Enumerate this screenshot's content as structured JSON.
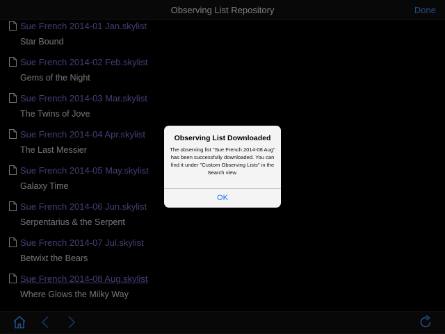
{
  "navbar": {
    "title": "Observing List Repository",
    "done_label": "Done"
  },
  "list": {
    "items": [
      {
        "file": "Sue French 2014-01 Jan.skylist",
        "title": "Star Bound",
        "icon": "document-icon"
      },
      {
        "file": "Sue French 2014-02 Feb.skylist",
        "title": "Gems of the Night",
        "icon": "document-icon"
      },
      {
        "file": "Sue French 2014-03 Mar.skylist",
        "title": "The Twins of Jove",
        "icon": "document-icon"
      },
      {
        "file": "Sue French 2014-04 Apr.skylist",
        "title": "The Last Messier",
        "icon": "document-icon"
      },
      {
        "file": "Sue French 2014-05 May.skylist",
        "title": "Galaxy Time",
        "icon": "document-icon"
      },
      {
        "file": "Sue French 2014-06 Jun.skylist",
        "title": "Serpentarius & the Serpent",
        "icon": "document-icon"
      },
      {
        "file": "Sue French 2014-07 Jul.skylist",
        "title": "Betwixt the Bears",
        "icon": "document-icon"
      },
      {
        "file": "Sue French 2014-08 Aug.skylist",
        "title": "Where Glows the Milky Way",
        "icon": "document-icon"
      }
    ]
  },
  "alert": {
    "title": "Observing List Downloaded",
    "message": "The observing list \"Sue French 2014-08 Aug\" has been successfully downloaded. You can find it under \"Custom Observing Lists\" in the Search view.",
    "ok_label": "OK"
  },
  "toolbar": {
    "icons": [
      "home-icon",
      "back-chevron-icon",
      "forward-chevron-icon",
      "refresh-icon"
    ]
  },
  "colors": {
    "accent": "#3f8ff5",
    "link": "#7a74d6",
    "background": "#000000"
  }
}
